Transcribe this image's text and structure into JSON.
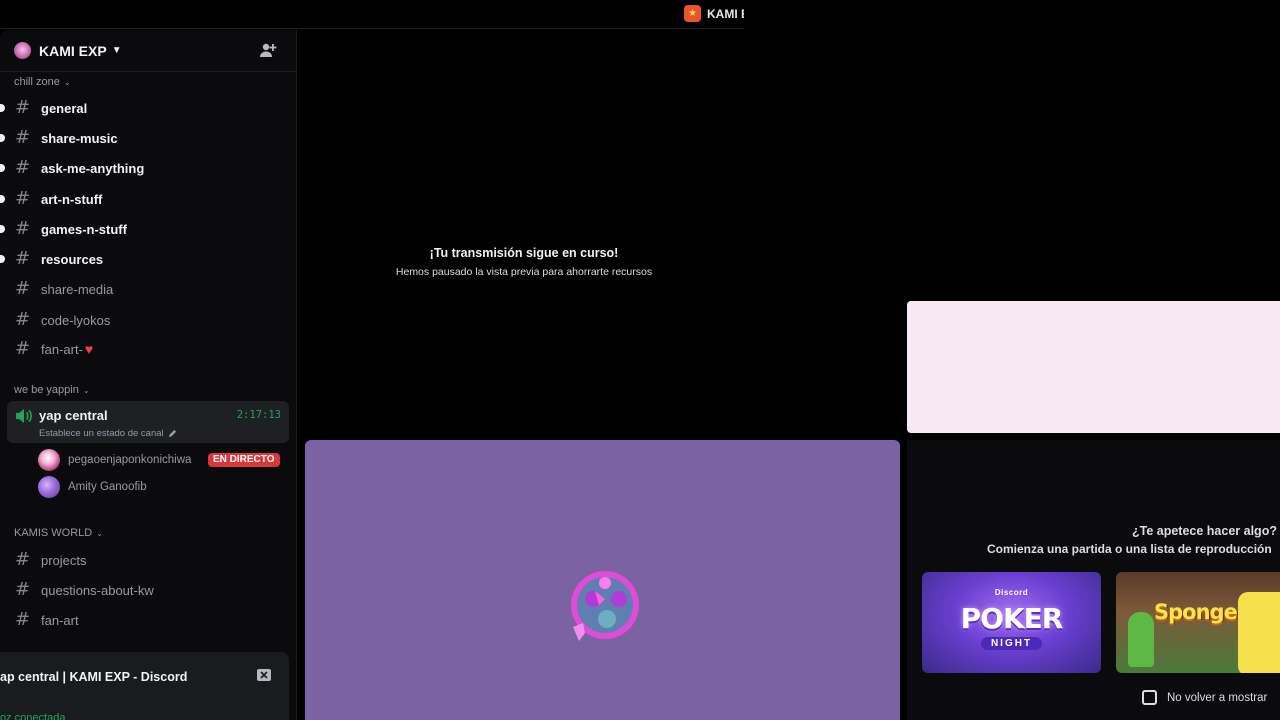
{
  "window": {
    "title": "KAMI E"
  },
  "server": {
    "name": "KAMI EXP"
  },
  "categories": {
    "chill_zone": "chill zone",
    "we_be_yappin": "we be yappin",
    "kamis_world": "KAMIS WORLD"
  },
  "channels": {
    "general": "general",
    "share_music": "share-music",
    "ask_me_anything": "ask-me-anything",
    "art_n_stuff": "art-n-stuff",
    "games_n_stuff": "games-n-stuff",
    "resources": "resources",
    "share_media": "share-media",
    "code_lyokos": "code-lyokos",
    "fan_art_heart": "fan-art-",
    "projects": "projects",
    "questions_about_kw": "questions-about-kw",
    "fan_art": "fan-art"
  },
  "voice": {
    "name": "yap central",
    "timer": "2:17:13",
    "status_placeholder": "Establece un estado de canal",
    "users": [
      {
        "name": "pegaoenjaponkonichiwa",
        "live": true
      },
      {
        "name": "Amity Ganoofib",
        "live": false
      }
    ],
    "live_label": "EN DIRECTO"
  },
  "popout": {
    "title": "ap central | KAMI EXP - Discord",
    "status": "oz conectada"
  },
  "stream": {
    "title": "¡Tu transmisión sigue en curso!",
    "subtitle": "Hemos pausado la vista previa para ahorrarte recursos"
  },
  "suggest": {
    "title": "¿Te apetece hacer algo?",
    "subtitle": "Comienza una partida o una lista de reproducción"
  },
  "activities": {
    "poker_brand": "Discord",
    "poker_word": "POKER",
    "poker_night": "NIGHT",
    "spongebob_word": "SpongeBob"
  },
  "dont_show_again": "No volver a mostrar",
  "colors": {
    "online_green": "#23a55a",
    "live_red": "#da373c",
    "tile_purple": "#7b62a3",
    "panel_pink": "#f6e9f3"
  }
}
